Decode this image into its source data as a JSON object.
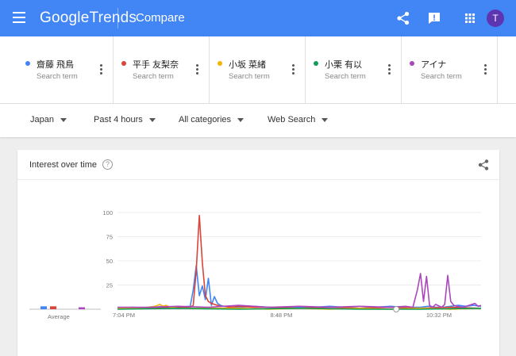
{
  "header": {
    "brand_google": "Google",
    "brand_trends": "Trends",
    "title": "Compare",
    "avatar_letter": "T",
    "icons": [
      "menu-icon",
      "share-icon",
      "feedback-icon",
      "apps-icon"
    ]
  },
  "terms": [
    {
      "name": "齋藤 飛鳥",
      "sub": "Search term",
      "color": "#4285f4"
    },
    {
      "name": "平手 友梨奈",
      "sub": "Search term",
      "color": "#db4437"
    },
    {
      "name": "小坂 菜緒",
      "sub": "Search term",
      "color": "#f4b400"
    },
    {
      "name": "小栗 有以",
      "sub": "Search term",
      "color": "#0f9d58"
    },
    {
      "name": "アイナ",
      "sub": "Search term",
      "color": "#ab47bc"
    }
  ],
  "filters": {
    "region": "Japan",
    "time": "Past 4 hours",
    "category": "All categories",
    "search_type": "Web Search"
  },
  "card": {
    "title": "Interest over time",
    "help_symbol": "?"
  },
  "chart_data": {
    "type": "line",
    "title": "Interest over time",
    "ylim": [
      0,
      100
    ],
    "yticks": [
      0,
      25,
      50,
      75,
      100
    ],
    "ytick_labels": [
      "",
      "25",
      "50",
      "75",
      "100"
    ],
    "xtick_labels": [
      "7:04 PM",
      "8:48 PM",
      "10:32 PM"
    ],
    "xtick_positions": [
      0,
      104,
      208
    ],
    "xlim": [
      0,
      240
    ],
    "grid": true,
    "average_label": "Average",
    "averages": [
      3,
      3,
      0,
      0,
      2
    ],
    "series": [
      {
        "name": "齋藤 飛鳥",
        "color": "#4285f4",
        "x": [
          0,
          10,
          20,
          30,
          40,
          48,
          50,
          52,
          54,
          56,
          58,
          60,
          62,
          64,
          66,
          68,
          70,
          75,
          80,
          90,
          100,
          110,
          120,
          130,
          140,
          150,
          160,
          170,
          180,
          190,
          200,
          205,
          210,
          215,
          220,
          225,
          230,
          235,
          240
        ],
        "y": [
          1,
          2,
          1,
          3,
          2,
          3,
          20,
          45,
          14,
          24,
          10,
          32,
          4,
          13,
          6,
          4,
          3,
          2,
          2,
          3,
          2,
          1,
          2,
          2,
          3,
          2,
          1,
          2,
          3,
          2,
          2,
          3,
          2,
          2,
          3,
          4,
          3,
          4,
          3
        ]
      },
      {
        "name": "平手 友梨奈",
        "color": "#db4437",
        "x": [
          0,
          20,
          40,
          48,
          50,
          52,
          54,
          56,
          58,
          60,
          62,
          64,
          66,
          68,
          70,
          75,
          80,
          90,
          100,
          120,
          140,
          160,
          180,
          200,
          220,
          240
        ],
        "y": [
          1,
          1,
          2,
          2,
          4,
          40,
          97,
          48,
          14,
          8,
          6,
          5,
          4,
          3,
          3,
          2,
          3,
          2,
          2,
          1,
          2,
          1,
          2,
          1,
          2,
          1
        ]
      },
      {
        "name": "小坂 菜緒",
        "color": "#f4b400",
        "x": [
          0,
          15,
          25,
          28,
          30,
          32,
          35,
          40,
          50,
          60,
          80,
          100,
          120,
          140,
          160,
          180,
          200,
          220,
          240
        ],
        "y": [
          1,
          1,
          3,
          5,
          3,
          4,
          2,
          1,
          1,
          1,
          1,
          0,
          1,
          0,
          1,
          0,
          1,
          0,
          1
        ]
      },
      {
        "name": "小栗 有以",
        "color": "#0f9d58",
        "x": [
          0,
          40,
          80,
          120,
          160,
          200,
          240
        ],
        "y": [
          0,
          1,
          0,
          1,
          0,
          0,
          1
        ]
      },
      {
        "name": "アイナ",
        "color": "#ab47bc",
        "x": [
          0,
          20,
          40,
          60,
          80,
          100,
          120,
          140,
          160,
          180,
          190,
          195,
          198,
          200,
          202,
          204,
          206,
          208,
          210,
          214,
          216,
          218,
          220,
          222,
          224,
          228,
          232,
          236,
          238,
          240
        ],
        "y": [
          2,
          2,
          3,
          2,
          4,
          2,
          3,
          2,
          3,
          2,
          3,
          2,
          20,
          37,
          8,
          34,
          4,
          2,
          5,
          2,
          5,
          35,
          8,
          4,
          3,
          2,
          4,
          6,
          3,
          4
        ]
      }
    ]
  }
}
